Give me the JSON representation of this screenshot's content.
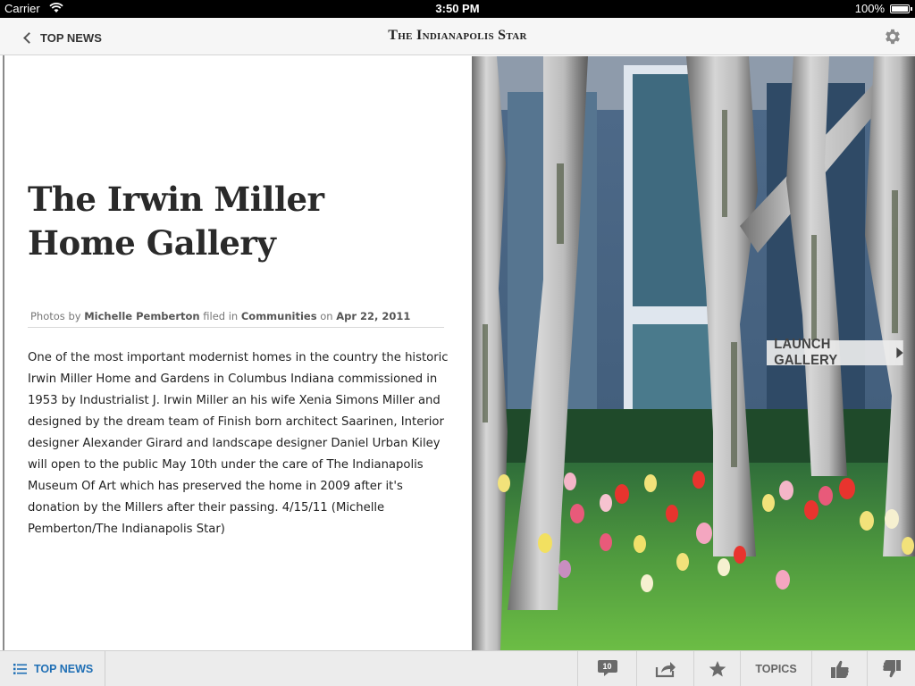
{
  "status_bar": {
    "carrier": "Carrier",
    "time": "3:50 PM",
    "battery": "100%"
  },
  "nav": {
    "back_label": "TOP NEWS",
    "masthead": "The Indianapolis Star"
  },
  "article": {
    "title": "The Irwin Miller Home Gallery",
    "byline": {
      "photos_by_label": "Photos by",
      "author": "Michelle Pemberton",
      "filed_in_label": "filed in",
      "category": "Communities",
      "on_label": "on",
      "date": "Apr 22, 2011"
    },
    "body": "One of the most important modernist homes in the country the historic Irwin Miller Home and Gardens in Columbus Indiana commissioned in 1953 by Industrialist J. Irwin Miller an his wife Xenia Simons Miller and designed by the dream team of Finish born architect Saarinen, Interior designer Alexander Girard and landscape designer Daniel Urban Kiley will open to the public May 10th under the care of The Indianapolis Museum Of Art which has preserved the home in 2009 after it's donation by the Millers after their passing. 4/15/11 (Michelle Pemberton/The Indianapolis Star)"
  },
  "photo": {
    "launch_label": "LAUNCH GALLERY"
  },
  "toolbar": {
    "top_news_label": "TOP NEWS",
    "comment_count": "10",
    "topics_label": "TOPICS"
  },
  "icons": {
    "back": "chevron-left-icon",
    "settings": "gear-icon",
    "list": "list-icon",
    "comments": "comment-bubble-icon",
    "share": "share-arrow-icon",
    "favorite": "star-icon",
    "like": "thumbs-up-icon",
    "dislike": "thumbs-down-icon",
    "launch": "play-triangle-icon"
  },
  "colors": {
    "accent": "#1f6fb5",
    "status_bar": "#000000",
    "toolbar_bg": "#ececec"
  }
}
